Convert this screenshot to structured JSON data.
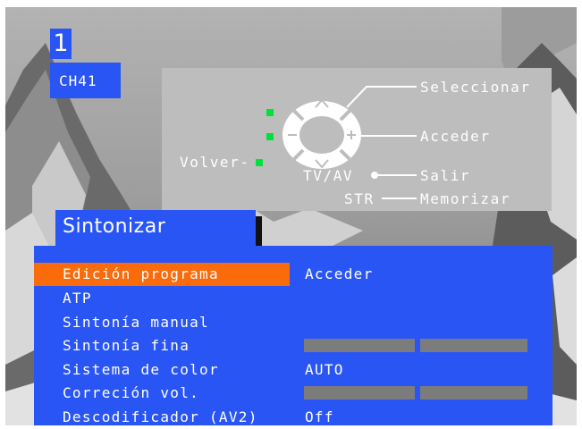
{
  "channel": {
    "number": "1",
    "name": "CH41"
  },
  "help": {
    "seleccionar": "Seleccionar",
    "acceder": "Acceder",
    "volver": "Volver-",
    "tvav": "TV/AV",
    "salir": "Salir",
    "str": "STR",
    "memorizar": "Memorizar",
    "led_color": "#00e23a",
    "icon": "navigation-pad-icon"
  },
  "menu": {
    "title": "Sintonizar",
    "selected_color": "#fa6b0c",
    "background_color": "#2a55f5",
    "items": [
      {
        "label": "Edición programa",
        "value": "Acceder",
        "selected": true
      },
      {
        "label": "ATP",
        "value": ""
      },
      {
        "label": "Sintonía manual",
        "value": ""
      },
      {
        "label": "Sintonía fina",
        "value": ""
      },
      {
        "label": "Sistema de color",
        "value": "AUTO"
      },
      {
        "label": "Correción vol.",
        "value": ""
      },
      {
        "label": "Descodificador (AV2)",
        "value": "Off"
      }
    ]
  }
}
